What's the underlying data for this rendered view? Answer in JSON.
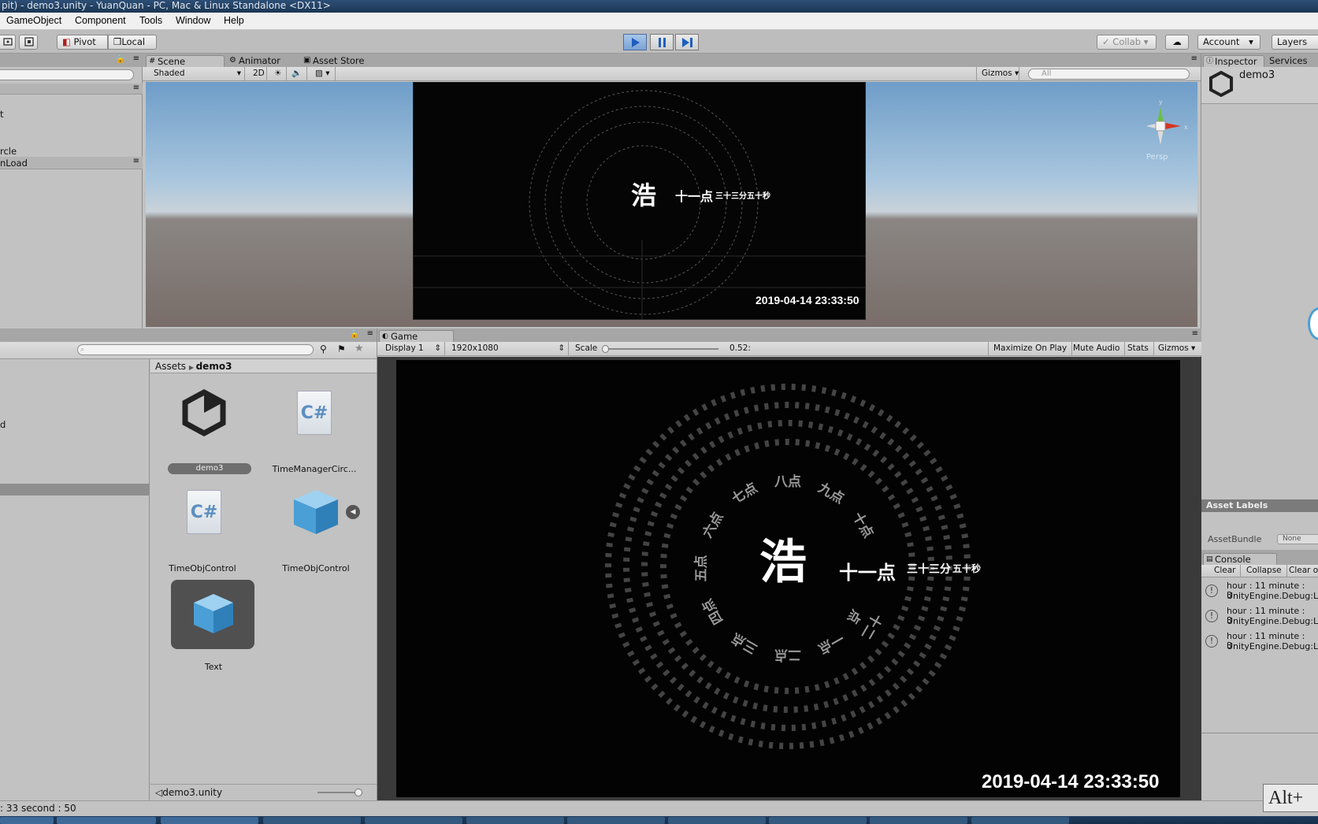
{
  "window": {
    "title": "pit) - demo3.unity - YuanQuan - PC, Mac & Linux Standalone <DX11>"
  },
  "menu": [
    "GameObject",
    "Component",
    "Tools",
    "Window",
    "Help"
  ],
  "toolbar": {
    "pivot": "Pivot",
    "local": "Local",
    "collab": "Collab",
    "account": "Account",
    "layers": "Layers"
  },
  "hierarchy": {
    "items": [
      "t",
      "rcle",
      "nLoad"
    ]
  },
  "scene": {
    "tabs": [
      "Scene",
      "Animator",
      "Asset Store"
    ],
    "shading": "Shaded",
    "mode_2d": "2D",
    "gizmos": "Gizmos",
    "search_placeholder": "All",
    "persp": "Persp",
    "center_char": "浩",
    "hour_text": "十一点",
    "minsec_text": "三十三分五十秒",
    "datetime": "2019-04-14 23:33:50"
  },
  "project": {
    "breadcrumb_root": "Assets",
    "breadcrumb_folder": "demo3",
    "left_items": [
      "d"
    ],
    "assets": [
      "demo3",
      "TimeManagerCirc...",
      "TimeObjControl",
      "TimeObjControl",
      "Text"
    ],
    "footer_file": "demo3.unity"
  },
  "game": {
    "tab": "Game",
    "display": "Display 1",
    "resolution": "1920x1080",
    "scale_label": "Scale",
    "scale_value": "0.52:",
    "maximize": "Maximize On Play",
    "mute": "Mute Audio",
    "stats": "Stats",
    "gizmos": "Gizmos",
    "center_char": "浩",
    "hour_text": "十一点",
    "minute_text": "三十三分",
    "second_text": "五十秒",
    "datetime": "2019-04-14 23:33:50",
    "hours": [
      "十二点",
      "一点",
      "二点",
      "三点",
      "四点",
      "五点",
      "六点",
      "七点",
      "八点",
      "九点",
      "十点"
    ]
  },
  "inspector": {
    "tabs": [
      "Inspector",
      "Services"
    ],
    "object_name": "demo3",
    "asset_labels": "Asset Labels",
    "asset_bundle": "AssetBundle",
    "asset_bundle_value": "None"
  },
  "console": {
    "tab": "Console",
    "buttons": [
      "Clear",
      "Collapse",
      "Clear or"
    ],
    "rows": [
      {
        "line1": "hour : 11 minute : 3",
        "line2": "UnityEngine.Debug:L"
      },
      {
        "line1": "hour : 11 minute : 3",
        "line2": "UnityEngine.Debug:L"
      },
      {
        "line1": "hour : 11 minute : 3",
        "line2": "UnityEngine.Debug:L"
      }
    ]
  },
  "status": {
    "text": ": 33 second : 50",
    "alt_hint": "Alt+"
  }
}
